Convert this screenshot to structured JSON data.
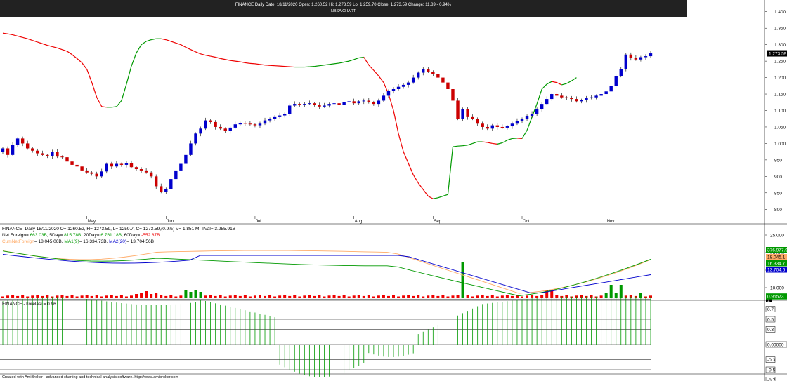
{
  "header": {
    "line1": "FINANCE Daily  Date: 18/11/2020  Open:  1.260.52  Hi:  1.273.59  Lo:  1.259.70  Close:  1.273.59  Change:  11.89 - 0.94%",
    "line2": "NBSA CHART"
  },
  "panel2": {
    "info1": "FINANCE- Daily 18/11/2020 O= 1260.52, H= 1273.59, L= 1259.7, C= 1273.59,(0.9%) V= 1.851 M, TVal= 3.255.91B",
    "net_label": "Net Foreign= ",
    "net_value": "663.03B",
    "d5_label": ",  5Day= ",
    "d5_value": "815.78B",
    "d20_label": ",  20Day= ",
    "d20_value": "6.761.18B",
    "d60_label": ",  60Day= ",
    "d60_value": "-552.87B",
    "cum_label": "CumNetForeign",
    "cum_value": "= 18.045.06B,",
    "ma1_label": "  MA1(9)",
    "ma1_value": "= 16.334.73B,",
    "ma2_label": "  MA2(20)",
    "ma2_value": "= 13.704.56B"
  },
  "panel3": {
    "title": "FINANCE - korelasi = 0.96"
  },
  "footer": "Created with AmiBroker - advanced charting and technical analysis software. http://www.amibroker.com",
  "colors": {
    "up": "#0000cc",
    "down": "#cc0000",
    "band_up": "#009900",
    "band_down": "#ee0000",
    "bar_pos": "#009900",
    "bar_neg": "#ee0000",
    "ma1": "#009900",
    "ma2": "#0000cc",
    "cum": "#ffaa66"
  },
  "chart_data": [
    {
      "type": "candlestick",
      "title": "FINANCE Daily",
      "x": [
        "May",
        "Jun",
        "Jul",
        "Aug",
        "Sep",
        "Oct",
        "Nov"
      ],
      "ylim": [
        775,
        1425
      ],
      "yticks": [
        "800",
        "850",
        "900",
        "950",
        "1.000",
        "1.050",
        "1.100",
        "1.150",
        "1.200",
        "1.250",
        "1.300",
        "1.350",
        "1.400"
      ],
      "last_close_label": "1.273.59",
      "series": [
        {
          "name": "price",
          "values": [
            985,
            965,
            995,
            1015,
            1000,
            985,
            978,
            970,
            965,
            962,
            975,
            960,
            958,
            945,
            935,
            930,
            918,
            912,
            908,
            900,
            915,
            938,
            930,
            938,
            935,
            940,
            928,
            922,
            918,
            912,
            900,
            870,
            853,
            862,
            892,
            918,
            938,
            965,
            1000,
            1030,
            1045,
            1070,
            1065,
            1050,
            1045,
            1038,
            1048,
            1058,
            1062,
            1060,
            1058,
            1055,
            1060,
            1070,
            1075,
            1080,
            1085,
            1090,
            1115,
            1120,
            1118,
            1120,
            1122,
            1118,
            1112,
            1115,
            1120,
            1122,
            1118,
            1125,
            1128,
            1122,
            1128,
            1130,
            1125,
            1120,
            1130,
            1145,
            1160,
            1165,
            1172,
            1178,
            1185,
            1200,
            1215,
            1225,
            1218,
            1210,
            1200,
            1185,
            1165,
            1130,
            1075,
            1105,
            1080,
            1075,
            1060,
            1050,
            1045,
            1055,
            1050,
            1048,
            1052,
            1060,
            1068,
            1075,
            1082,
            1090,
            1105,
            1120,
            1135,
            1150,
            1145,
            1140,
            1138,
            1135,
            1128,
            1132,
            1138,
            1140,
            1145,
            1150,
            1158,
            1175,
            1205,
            1225,
            1270,
            1260,
            1255,
            1262,
            1265,
            1273.59
          ]
        }
      ],
      "bands": [
        {
          "name": "band",
          "values": [
            1335,
            1333,
            1330,
            1326,
            1322,
            1318,
            1313,
            1308,
            1303,
            1298,
            1294,
            1290,
            1285,
            1280,
            1270,
            1258,
            1245,
            1225,
            1185,
            1140,
            1112,
            1110,
            1110,
            1112,
            1130,
            1180,
            1235,
            1275,
            1300,
            1310,
            1315,
            1318,
            1318,
            1315,
            1310,
            1305,
            1300,
            1292,
            1285,
            1278,
            1272,
            1268,
            1265,
            1262,
            1258,
            1255,
            1252,
            1250,
            1248,
            1245,
            1243,
            1242,
            1240,
            1238,
            1237,
            1236,
            1235,
            1234,
            1233,
            1232,
            1232,
            1232,
            1233,
            1234,
            1236,
            1238,
            1240,
            1242,
            1244,
            1247,
            1250,
            1255,
            1260,
            1262,
            1238,
            1222,
            1205,
            1185,
            1150,
            1100,
            1030,
            975,
            940,
            905,
            880,
            860,
            840,
            832,
            835,
            840,
            845,
            990,
            992,
            993,
            995,
            1000,
            1005,
            1005,
            1003,
            1000,
            998,
            1002,
            1010,
            1015,
            1016,
            1015,
            1040,
            1080,
            1120,
            1165,
            1180,
            1188,
            1185,
            1178,
            1182,
            1190,
            1200
          ]
        }
      ]
    },
    {
      "type": "bar+line",
      "title": "Net Foreign",
      "yticks": [
        "25.000",
        "20.000",
        "15.000",
        "10.000"
      ],
      "value_labels": [
        "376.977.9",
        "18.045.1",
        "16.334.7",
        "13.704.6"
      ]
    },
    {
      "type": "bar",
      "title": "FINANCE - korelasi",
      "yticks": [
        "0.7",
        "0.5",
        "0.3",
        "0.00000",
        "-0.3",
        "-0.5",
        "-0.7"
      ],
      "last_label": "0.95573",
      "top_label": "1"
    }
  ]
}
